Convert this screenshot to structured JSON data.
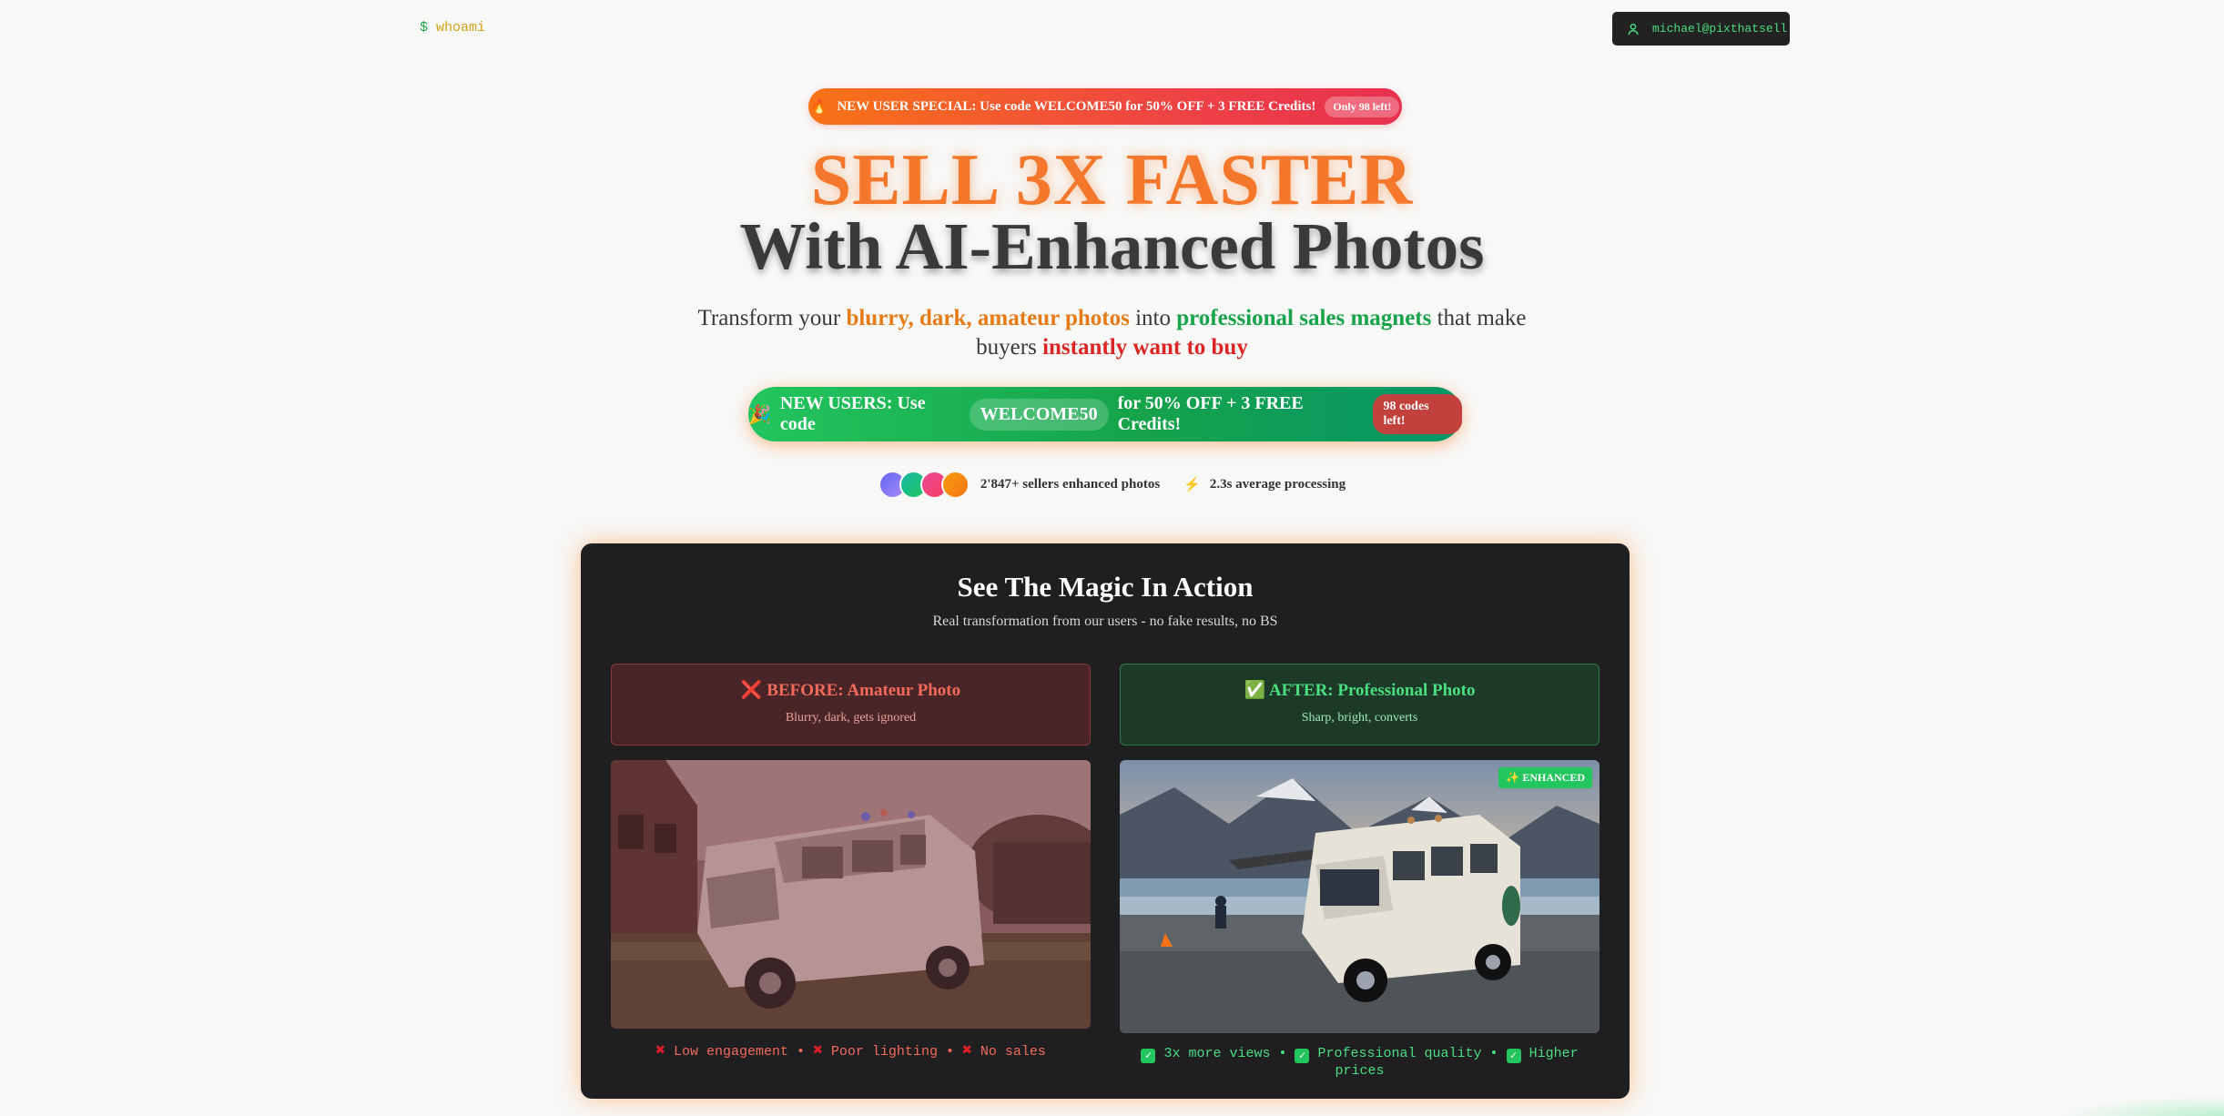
{
  "header": {
    "prompt_symbol": "$",
    "command": "whoami",
    "user_email": "michael@pixthatsell",
    "user_icon": "user-icon"
  },
  "promo_top": {
    "icon": "fire-icon",
    "text": "NEW USER SPECIAL: Use code WELCOME50 for 50% OFF + 3 FREE Credits!",
    "badge": "Only 98 left!"
  },
  "hero": {
    "line1": "SELL 3X FASTER",
    "line2": "With AI-Enhanced Photos"
  },
  "subtitle": {
    "p1": "Transform your ",
    "highlight_bad": "blurry, dark, amateur photos",
    "p2": " into ",
    "highlight_good": "professional sales magnets",
    "p3": " that make buyers ",
    "highlight_urgent": "instantly want to buy"
  },
  "cta": {
    "icon": "party-icon",
    "pre": "NEW USERS: Use code",
    "code": "WELCOME50",
    "post": "for 50% OFF + 3 FREE Credits!",
    "badge": "98 codes left!"
  },
  "proof": {
    "sellers": "2'847+ sellers enhanced photos",
    "icon": "lightning-icon",
    "speed": "2.3s average processing"
  },
  "magic": {
    "title": "See The Magic In Action",
    "subtitle": "Real transformation from our users - no fake results, no BS",
    "before": {
      "title": "BEFORE: Amateur Photo",
      "desc": "Blurry, dark, gets ignored",
      "captions": [
        "Low engagement",
        "Poor lighting",
        "No sales"
      ]
    },
    "after": {
      "title": "AFTER: Professional Photo",
      "desc": "Sharp, bright, converts",
      "badge": "✨ ENHANCED",
      "captions": [
        "3x more views",
        "Professional quality",
        "Higher prices"
      ]
    }
  },
  "colors": {
    "accent_orange": "#f4772b",
    "accent_green": "#22c55e",
    "accent_red": "#ef4444",
    "dark_card": "#1f1f21"
  }
}
